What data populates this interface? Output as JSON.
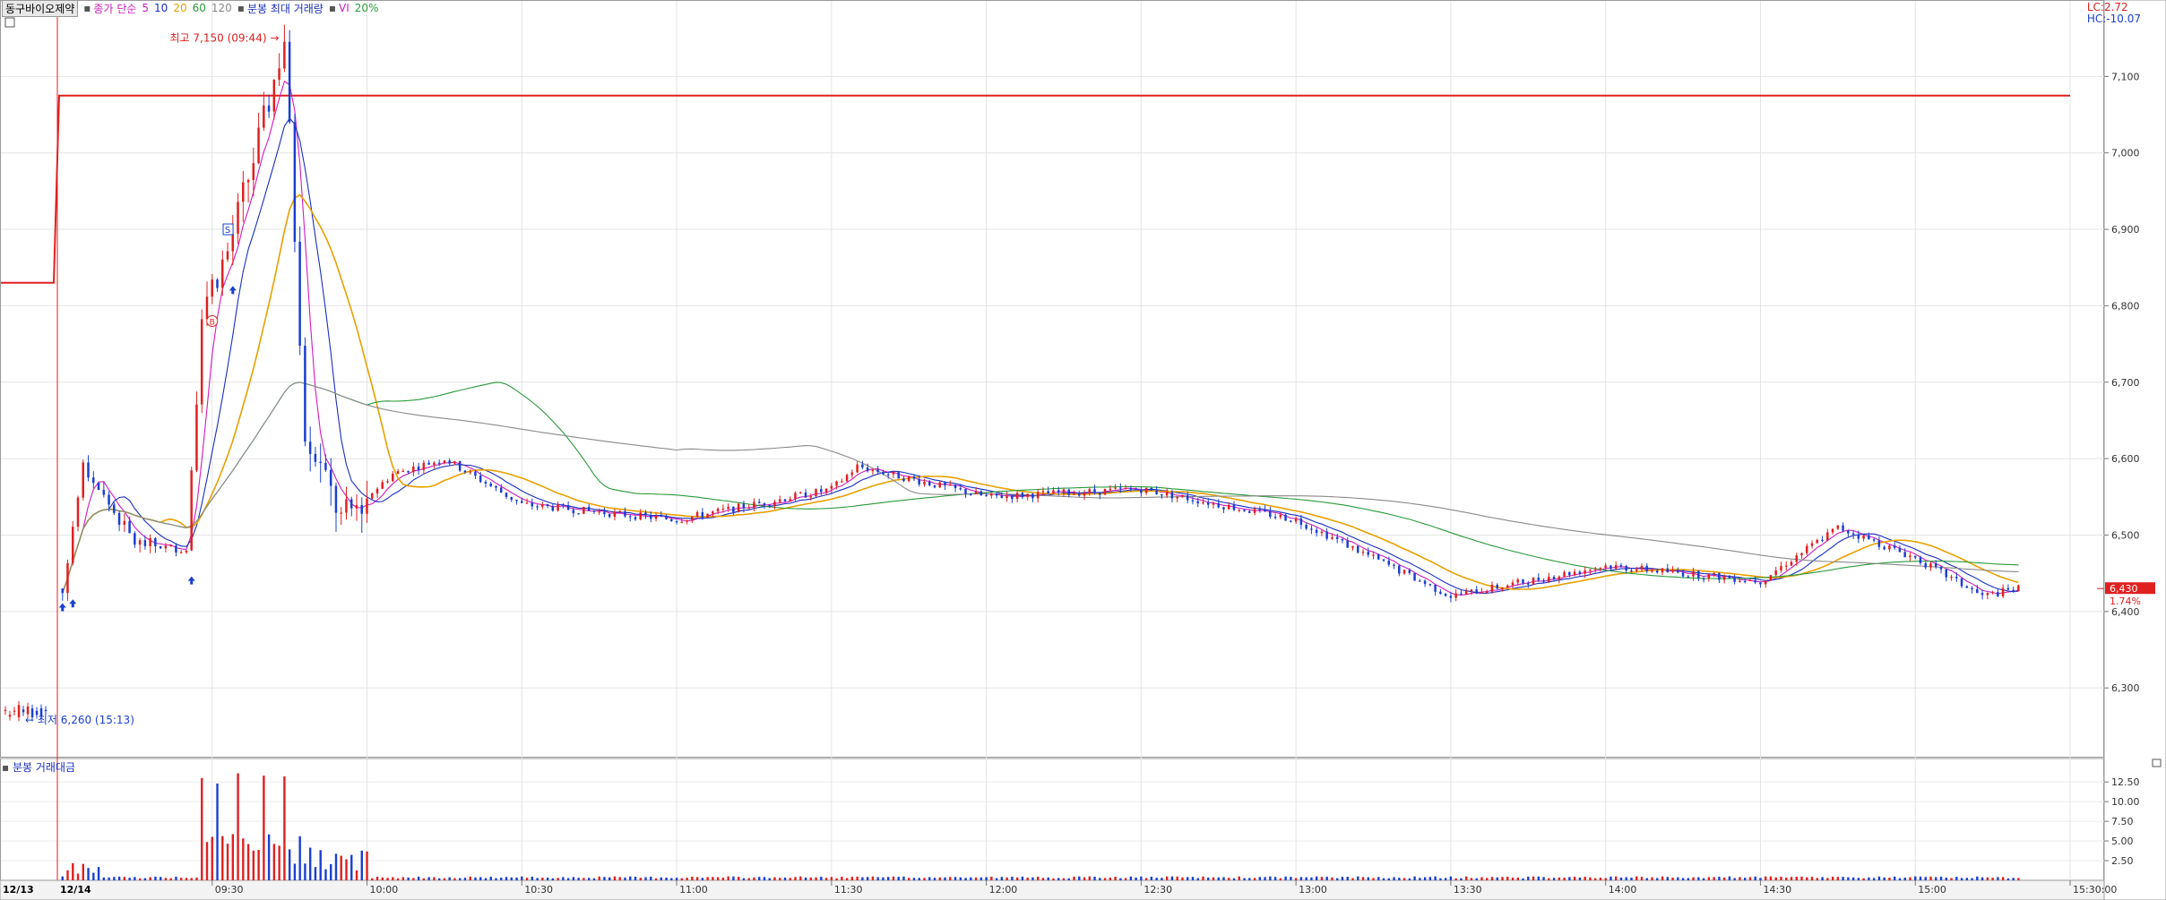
{
  "header": {
    "symbol": "동구바이오제약",
    "ma_label": "종가 단순",
    "ma_periods": [
      "5",
      "10",
      "20",
      "60",
      "120"
    ],
    "ma_colors": [
      "#d01cc0",
      "#1a2fbf",
      "#e8a000",
      "#2a9a3a",
      "#8a8a8a"
    ],
    "max_volume_label": "분봉 최대 거래량",
    "vi_label": "VI",
    "vi_value": "20%"
  },
  "lc_label": "LC:2.72",
  "hc_label": "HC:-10.07",
  "annotations": {
    "high": "최고 7,150 (09:44)",
    "low": "최저 6,260 (15:13)",
    "marker_s": "S",
    "marker_b": "B"
  },
  "current": {
    "price": "6,430",
    "change": "1.74%"
  },
  "volume_panel": {
    "title": "분봉 거래대금"
  },
  "colors": {
    "up": "#e02020",
    "down": "#1a3fd0",
    "ref_line": "#e02020",
    "current_bg": "#e02020"
  },
  "chart_data": [
    {
      "type": "candlestick",
      "title": "동구바이오제약",
      "ylim": [
        6210,
        7200
      ],
      "y_ticks": [
        "6,300",
        "6,400",
        "6,500",
        "6,600",
        "6,700",
        "6,800",
        "6,900",
        "7,000",
        "7,100"
      ],
      "x_date_labels": [
        "12/13",
        "12/14"
      ],
      "x_time_labels": [
        "09:30",
        "10:00",
        "10:30",
        "11:00",
        "11:30",
        "12:00",
        "12:30",
        "13:00",
        "13:30",
        "14:00",
        "14:30",
        "15:00",
        "15:30:00"
      ],
      "reference_line": {
        "prev": 6830,
        "now": 7075
      },
      "key_points": [
        {
          "time": "12/13",
          "price": 6270
        },
        {
          "time": "09:01",
          "price": 6430
        },
        {
          "time": "09:05",
          "price": 6590
        },
        {
          "time": "09:15",
          "price": 6490
        },
        {
          "time": "09:25",
          "price": 6480
        },
        {
          "time": "09:28",
          "price": 6800
        },
        {
          "time": "09:33",
          "price": 6870
        },
        {
          "time": "09:40",
          "price": 7040
        },
        {
          "time": "09:44",
          "price": 7150
        },
        {
          "time": "09:48",
          "price": 6640
        },
        {
          "time": "09:55",
          "price": 6520
        },
        {
          "time": "10:05",
          "price": 6580
        },
        {
          "time": "10:15",
          "price": 6600
        },
        {
          "time": "10:30",
          "price": 6540
        },
        {
          "time": "11:00",
          "price": 6520
        },
        {
          "time": "11:30",
          "price": 6560
        },
        {
          "time": "11:35",
          "price": 6590
        },
        {
          "time": "12:00",
          "price": 6550
        },
        {
          "time": "12:30",
          "price": 6560
        },
        {
          "time": "13:00",
          "price": 6520
        },
        {
          "time": "13:30",
          "price": 6420
        },
        {
          "time": "14:00",
          "price": 6460
        },
        {
          "time": "14:30",
          "price": 6440
        },
        {
          "time": "14:45",
          "price": 6510
        },
        {
          "time": "15:00",
          "price": 6470
        },
        {
          "time": "15:13",
          "price": 6420
        },
        {
          "time": "15:20",
          "price": 6430
        }
      ],
      "current_price": 6430
    },
    {
      "type": "bar",
      "title": "분봉 거래대금",
      "ylim": [
        0,
        14
      ],
      "y_ticks": [
        "2.50",
        "5.00",
        "7.50",
        "10.00",
        "12.50"
      ],
      "peaks": [
        {
          "time": "09:28",
          "value": 13.0
        },
        {
          "time": "09:31",
          "value": 12.3
        },
        {
          "time": "09:35",
          "value": 13.6
        },
        {
          "time": "09:40",
          "value": 13.3
        },
        {
          "time": "09:44",
          "value": 13.2
        }
      ]
    }
  ]
}
